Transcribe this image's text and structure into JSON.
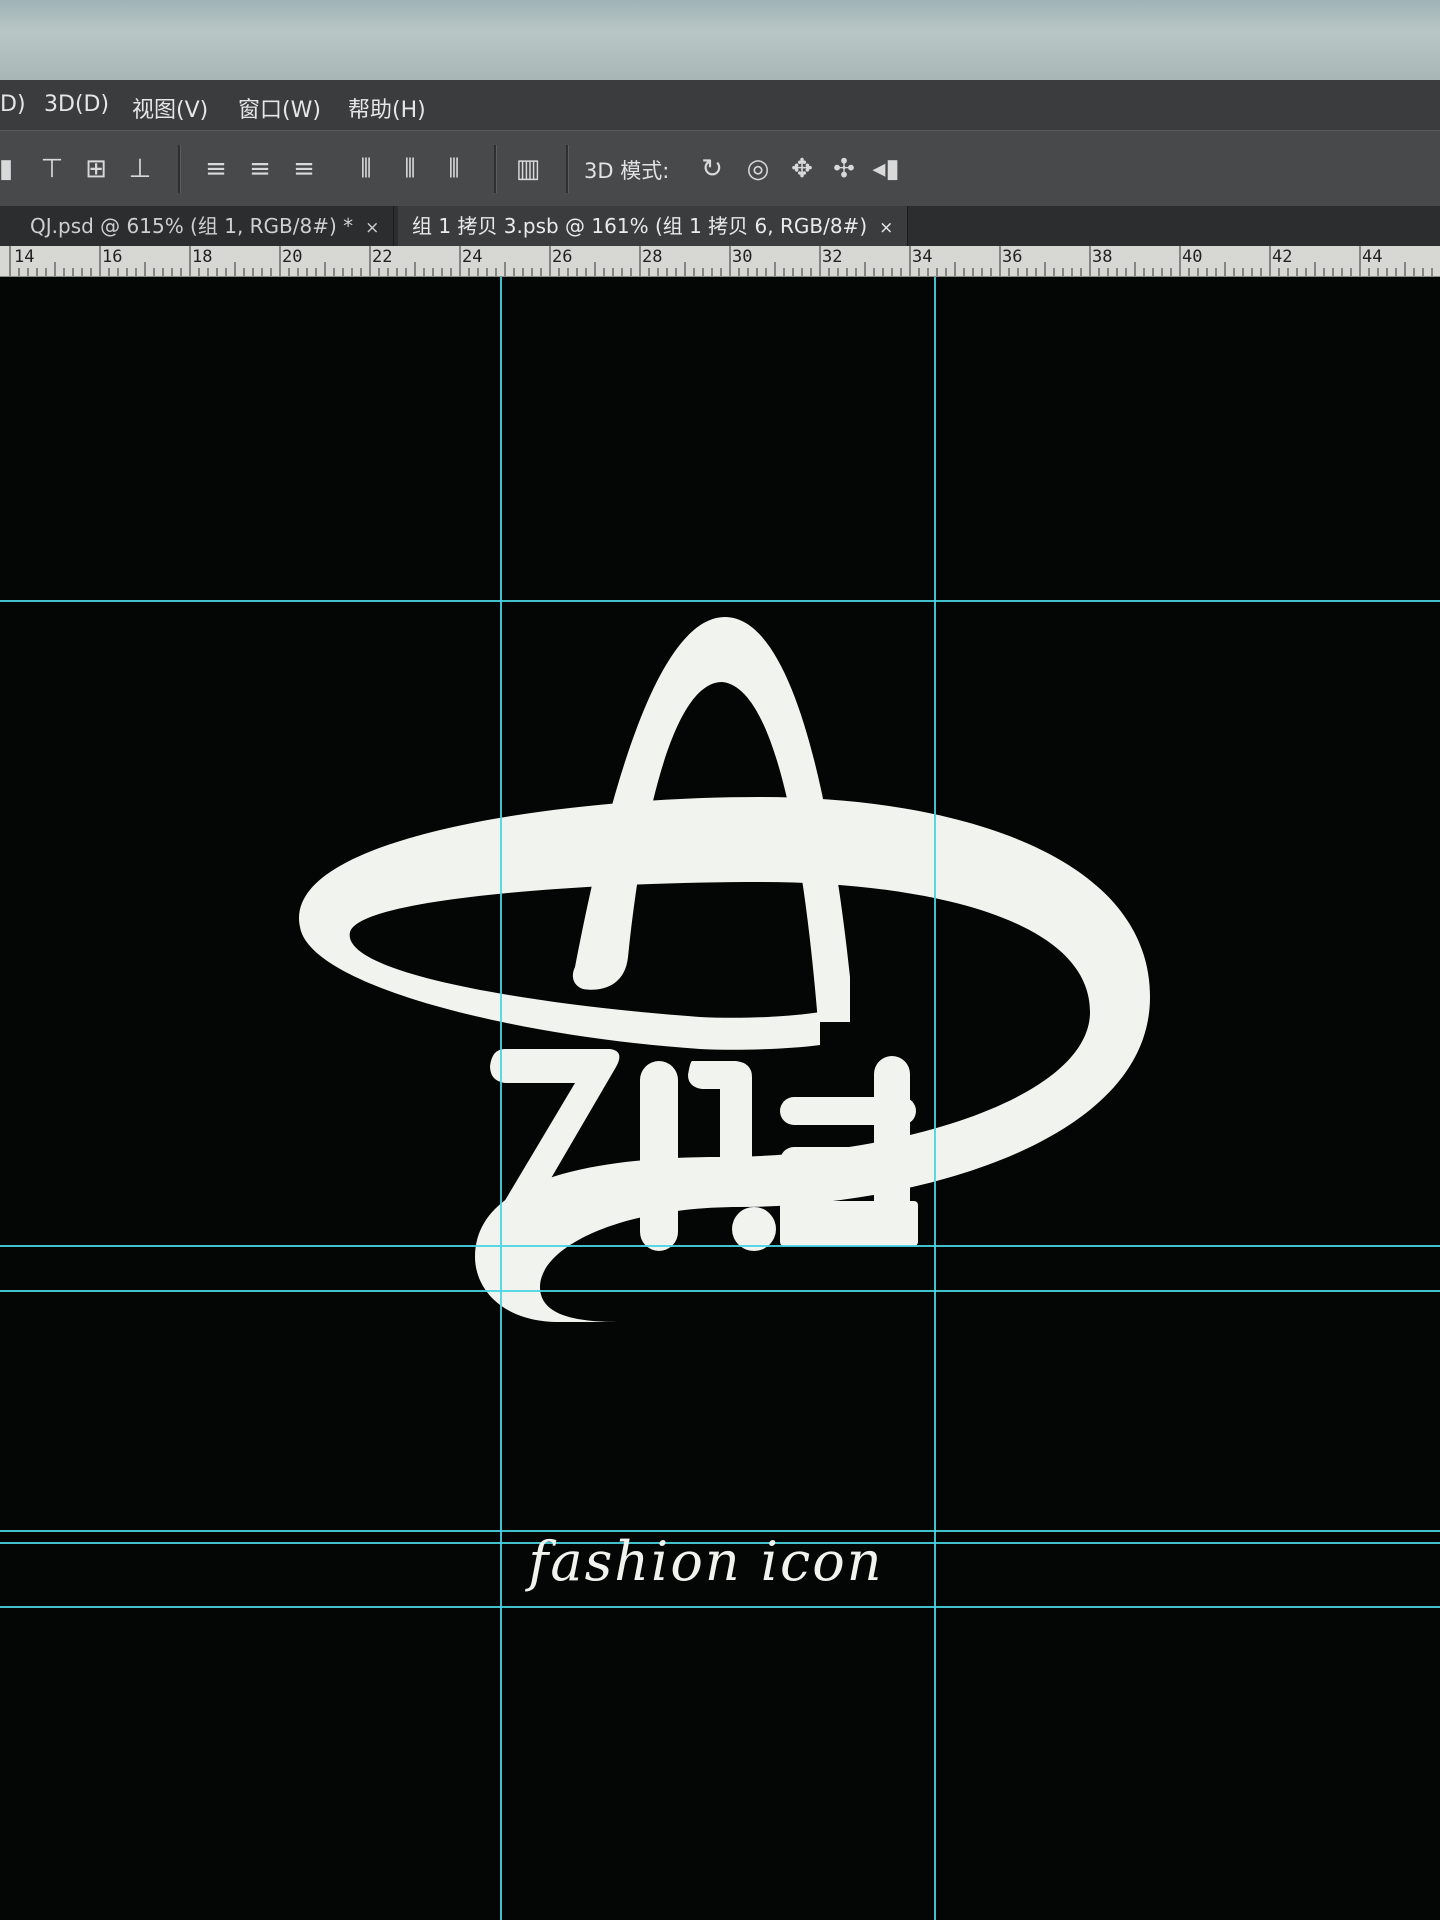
{
  "menu": {
    "items": [
      {
        "label": "D)"
      },
      {
        "label": "3D(D)"
      },
      {
        "label": "视图(V)"
      },
      {
        "label": "窗口(W)"
      },
      {
        "label": "帮助(H)"
      }
    ]
  },
  "options_bar": {
    "mode_label": "3D 模式:",
    "icons": [
      "align-top-icon",
      "align-vcenter-icon",
      "align-bottom-icon",
      "distribute-top-icon",
      "distribute-vcenter-icon",
      "distribute-bottom-icon",
      "distribute-left-icon",
      "distribute-hcenter-icon",
      "distribute-right-icon",
      "auto-align-icon",
      "rotate-3d-icon",
      "roll-3d-icon",
      "drag-3d-icon",
      "slide-3d-icon",
      "scale-3d-icon"
    ]
  },
  "tabs": [
    {
      "label": "QJ.psd @ 615% (组 1, RGB/8#) *",
      "close": "×"
    },
    {
      "label": "组 1 拷贝 3.psb @ 161% (组 1 拷贝 6, RGB/8#)",
      "close": "×"
    }
  ],
  "ruler": {
    "labels": [
      "14",
      "16",
      "18",
      "20",
      "22",
      "24",
      "26",
      "28",
      "30",
      "32",
      "34",
      "36",
      "38",
      "40",
      "42",
      "44"
    ]
  },
  "logo": {
    "wordmark": "fashion icon",
    "color": "#f1f3ef"
  },
  "colors": {
    "guide": "#49d6e3",
    "canvas": "#040606"
  }
}
